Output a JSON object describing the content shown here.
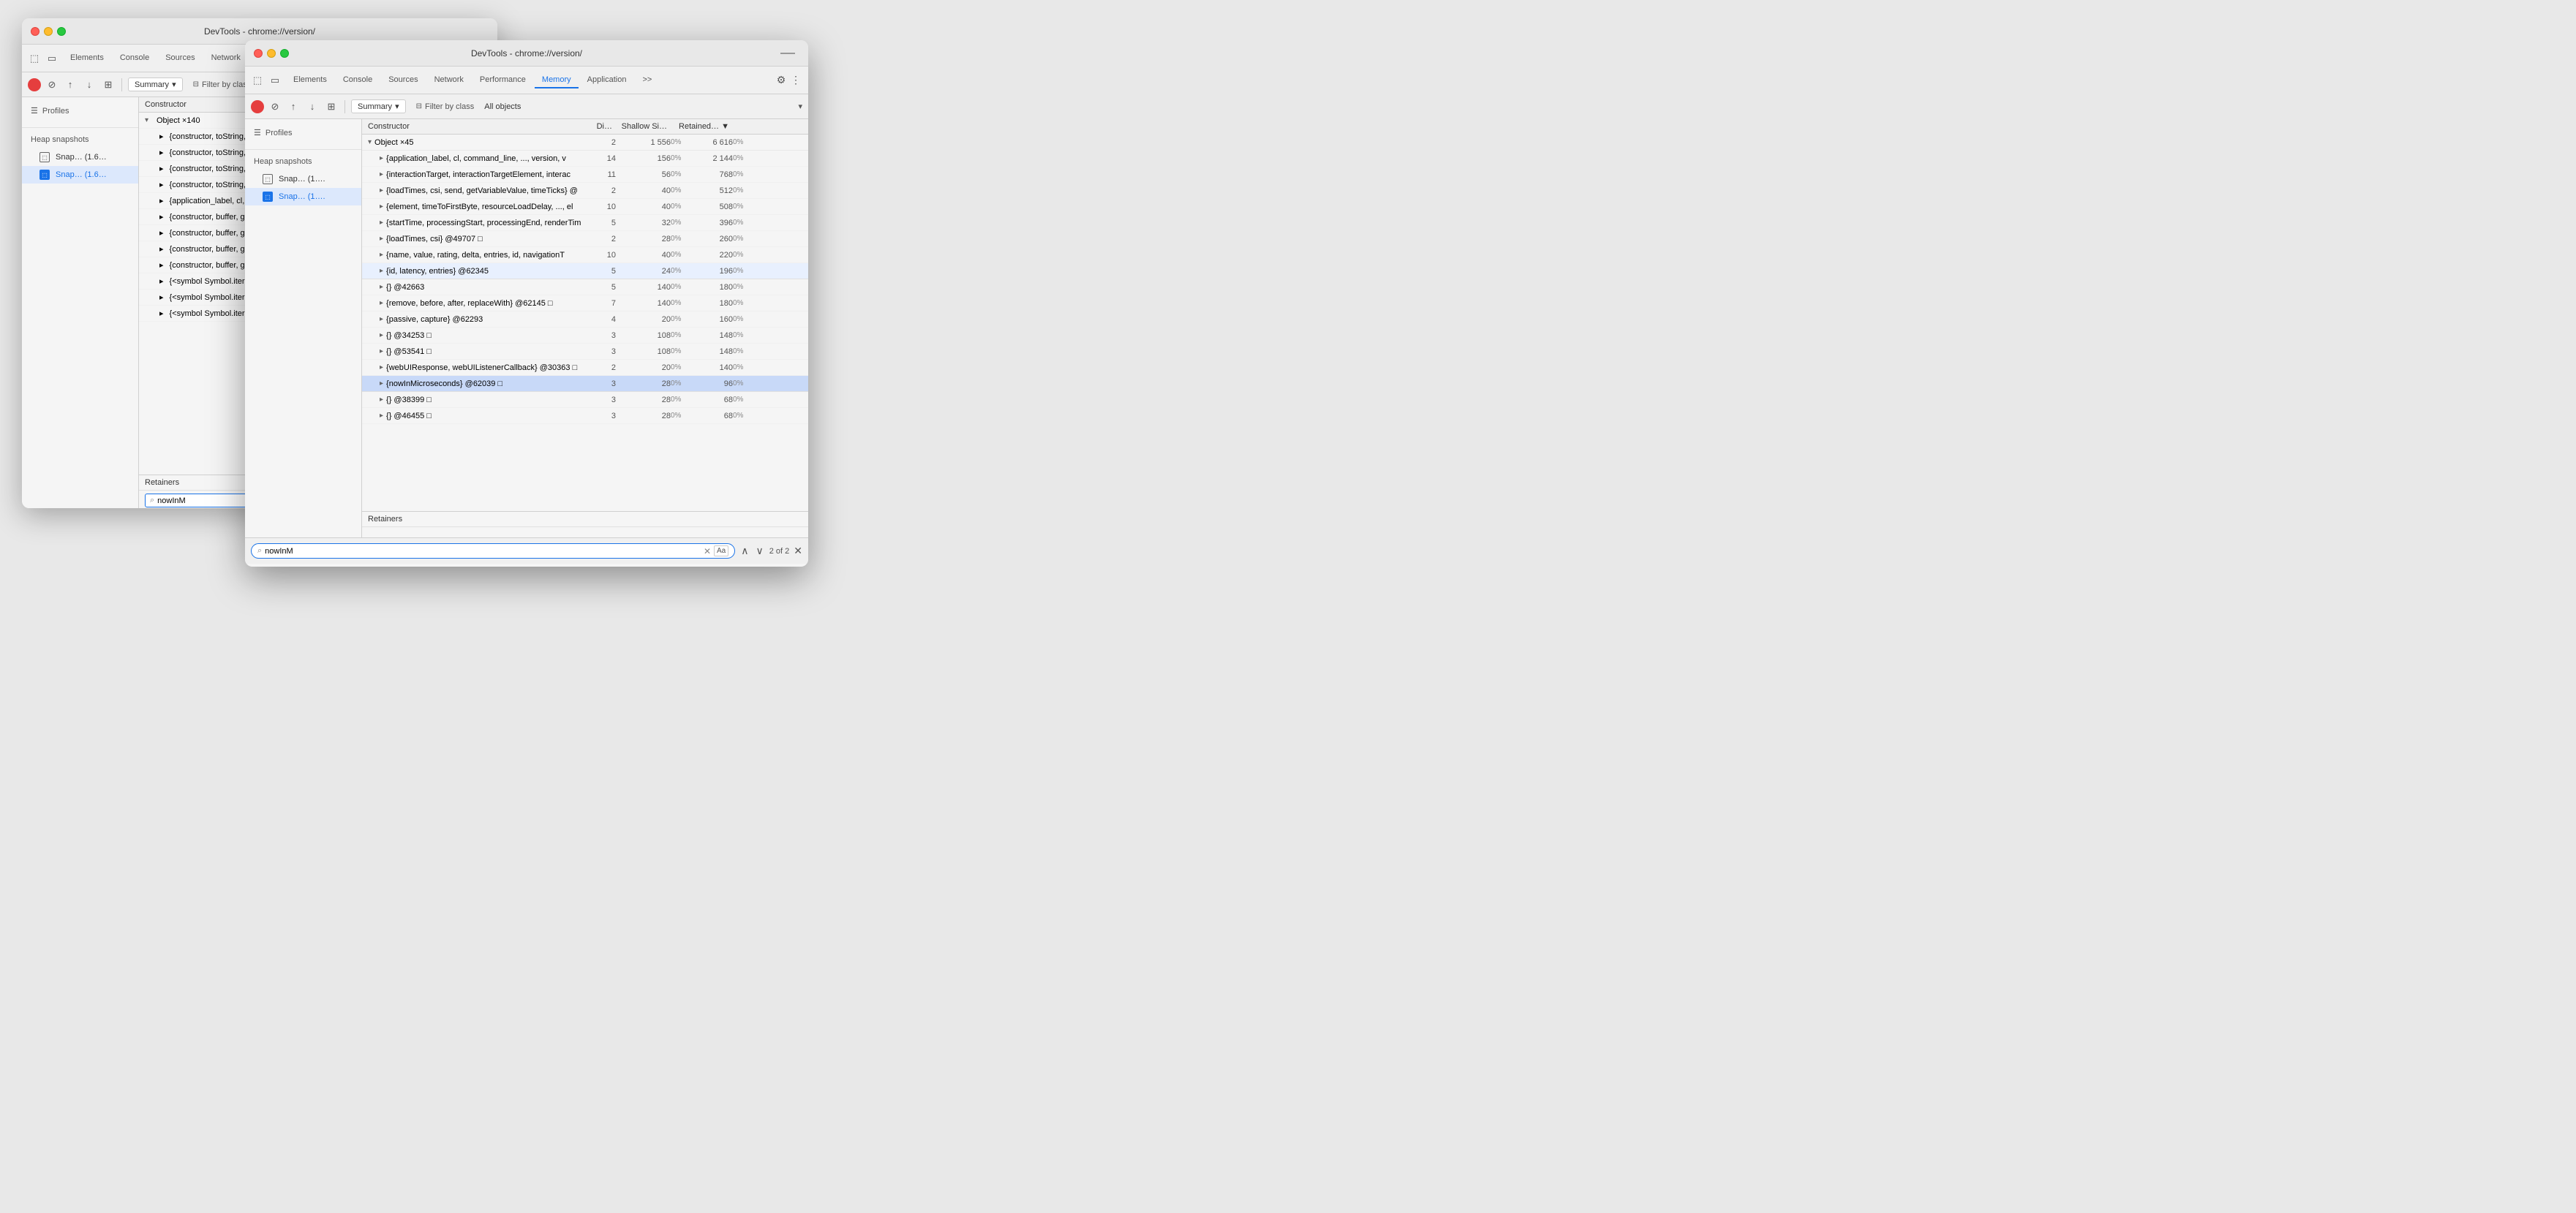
{
  "window_back": {
    "title": "DevTools - chrome://version/",
    "tabs": [
      "Elements",
      "Console",
      "Sources",
      "Network",
      "Performance",
      "Memory",
      "Application",
      ">>"
    ],
    "active_tab": "Memory",
    "toolbar2": {
      "summary_label": "Summary",
      "filter_label": "Filter by class",
      "all_objects_label": "All objects"
    },
    "sidebar": {
      "profiles_label": "Profiles",
      "heap_snapshots_label": "Heap snapshots",
      "items": [
        {
          "label": "Snap… (1.6…",
          "selected": false
        },
        {
          "label": "Snap… (1.6…",
          "selected": true
        }
      ]
    },
    "constructor_header": {
      "cols": [
        "Constructor",
        "Di…",
        "Shallow Si…",
        "Retained…"
      ]
    },
    "rows": [
      {
        "label": "Object ×140",
        "type": "section",
        "expanded": true,
        "indent": 0
      },
      {
        "label": "{constructor, toString, toDateString, ..., toLocale⊤",
        "indent": 1
      },
      {
        "label": "{constructor, toString, toDateString, ..., toLocale⊤",
        "indent": 1
      },
      {
        "label": "{constructor, toString, toDateString, ..., toLocale⊤",
        "indent": 1
      },
      {
        "label": "{constructor, toString, toDateString, ..., toLocale⊤",
        "indent": 1
      },
      {
        "label": "{application_label, cl, command_line, ..., version,",
        "indent": 1
      },
      {
        "label": "{constructor, buffer, get buffer, byteLength, get by",
        "indent": 1
      },
      {
        "label": "{constructor, buffer, get buffer, byteLength, get by",
        "indent": 1
      },
      {
        "label": "{constructor, buffer, get buffer, byteLength, get by",
        "indent": 1
      },
      {
        "label": "{constructor, buffer, get buffer, byteLength, get by",
        "indent": 1
      },
      {
        "label": "{<symbol Symbol.iterator>, constructor, get construct",
        "indent": 1
      },
      {
        "label": "{<symbol Symbol.iterator>, constructor, get construct",
        "indent": 1
      },
      {
        "label": "{<symbol Symbol.iterator>, constructor, get construct",
        "indent": 1
      }
    ],
    "retainers": {
      "label": "Retainers",
      "search_value": "nowInM"
    }
  },
  "window_front": {
    "title": "DevTools - chrome://version/",
    "tabs": [
      "Elements",
      "Console",
      "Sources",
      "Network",
      "Performance",
      "Memory",
      "Application",
      ">>"
    ],
    "active_tab": "Memory",
    "toolbar2": {
      "summary_label": "Summary",
      "filter_label": "Filter by class",
      "all_objects_label": "All objects"
    },
    "sidebar": {
      "profiles_label": "Profiles",
      "heap_snapshots_label": "Heap snapshots",
      "items": [
        {
          "label": "Snap… (1….",
          "selected": false
        },
        {
          "label": "Snap… (1….",
          "selected": true
        }
      ]
    },
    "constructor_header": {
      "cols": [
        "Constructor",
        "Di…",
        "Shallow Si…",
        "Retained…▼"
      ]
    },
    "rows": [
      {
        "label": "Object ×45",
        "type": "section",
        "expanded": true,
        "indent": 0,
        "di": "2",
        "shallow": "1 556",
        "shallow_pct": "0%",
        "retained": "6 616",
        "retained_pct": "0%"
      },
      {
        "label": "{application_label, cl, command_line, ..., version, v",
        "indent": 1,
        "di": "14",
        "shallow": "156",
        "shallow_pct": "0%",
        "retained": "2 144",
        "retained_pct": "0%"
      },
      {
        "label": "{interactionTarget, interactionTargetElement, interac",
        "indent": 1,
        "di": "11",
        "shallow": "56",
        "shallow_pct": "0%",
        "retained": "768",
        "retained_pct": "0%"
      },
      {
        "label": "{loadTimes, csi, send, getVariableValue, timeTicks} @",
        "indent": 1,
        "di": "2",
        "shallow": "40",
        "shallow_pct": "0%",
        "retained": "512",
        "retained_pct": "0%"
      },
      {
        "label": "{element, timeToFirstByte, resourceLoadDelay, ..., el",
        "indent": 1,
        "di": "10",
        "shallow": "40",
        "shallow_pct": "0%",
        "retained": "508",
        "retained_pct": "0%"
      },
      {
        "label": "{startTime, processingStart, processingEnd, renderTim",
        "indent": 1,
        "di": "5",
        "shallow": "32",
        "shallow_pct": "0%",
        "retained": "396",
        "retained_pct": "0%"
      },
      {
        "label": "{loadTimes, csi} @49707 □",
        "indent": 1,
        "di": "2",
        "shallow": "28",
        "shallow_pct": "0%",
        "retained": "260",
        "retained_pct": "0%"
      },
      {
        "label": "{name, value, rating, delta, entries, id, navigationT",
        "indent": 1,
        "di": "10",
        "shallow": "40",
        "shallow_pct": "0%",
        "retained": "220",
        "retained_pct": "0%"
      },
      {
        "label": "{id, latency, entries} @62345",
        "indent": 1,
        "di": "5",
        "shallow": "24",
        "shallow_pct": "0%",
        "retained": "196",
        "retained_pct": "0%",
        "highlighted": true
      },
      {
        "label": "{} @42663",
        "indent": 1,
        "di": "5",
        "shallow": "140",
        "shallow_pct": "0%",
        "retained": "180",
        "retained_pct": "0%"
      },
      {
        "label": "{remove, before, after, replaceWith} @62145 □",
        "indent": 1,
        "di": "7",
        "shallow": "140",
        "shallow_pct": "0%",
        "retained": "180",
        "retained_pct": "0%"
      },
      {
        "label": "{passive, capture} @62293",
        "indent": 1,
        "di": "4",
        "shallow": "20",
        "shallow_pct": "0%",
        "retained": "160",
        "retained_pct": "0%"
      },
      {
        "label": "{} @34253 □",
        "indent": 1,
        "di": "3",
        "shallow": "108",
        "shallow_pct": "0%",
        "retained": "148",
        "retained_pct": "0%"
      },
      {
        "label": "{} @53541 □",
        "indent": 1,
        "di": "3",
        "shallow": "108",
        "shallow_pct": "0%",
        "retained": "148",
        "retained_pct": "0%"
      },
      {
        "label": "{webUIResponse, webUIListenerCallback} @30363 □",
        "indent": 1,
        "di": "2",
        "shallow": "20",
        "shallow_pct": "0%",
        "retained": "140",
        "retained_pct": "0%"
      },
      {
        "label": "{nowInMicroseconds} @62039 □",
        "indent": 1,
        "di": "3",
        "shallow": "28",
        "shallow_pct": "0%",
        "retained": "96",
        "retained_pct": "0%",
        "row_highlighted": true
      },
      {
        "label": "{} @38399 □",
        "indent": 1,
        "di": "3",
        "shallow": "28",
        "shallow_pct": "0%",
        "retained": "68",
        "retained_pct": "0%"
      },
      {
        "label": "{} @46455 □",
        "indent": 1,
        "di": "3",
        "shallow": "28",
        "shallow_pct": "0%",
        "retained": "68",
        "retained_pct": "0%"
      }
    ],
    "retainers": {
      "label": "Retainers"
    },
    "bottom_search": {
      "value": "nowInM",
      "placeholder": "Search",
      "count": "2 of 2",
      "regex_label": "Aa"
    }
  },
  "icons": {
    "record": "⏺",
    "clear": "⊘",
    "upload": "↑",
    "download": "↓",
    "grid": "⊞",
    "settings": "⚙",
    "more": "⋮",
    "cursor": "⬚",
    "device": "▭",
    "chevron_down": "▾",
    "chevron_right": "▸",
    "filter": "⊟",
    "expand": "▸",
    "collapse": "▾",
    "search": "⌕",
    "close": "✕",
    "prev": "∧",
    "next": "∨",
    "file": "☰"
  }
}
